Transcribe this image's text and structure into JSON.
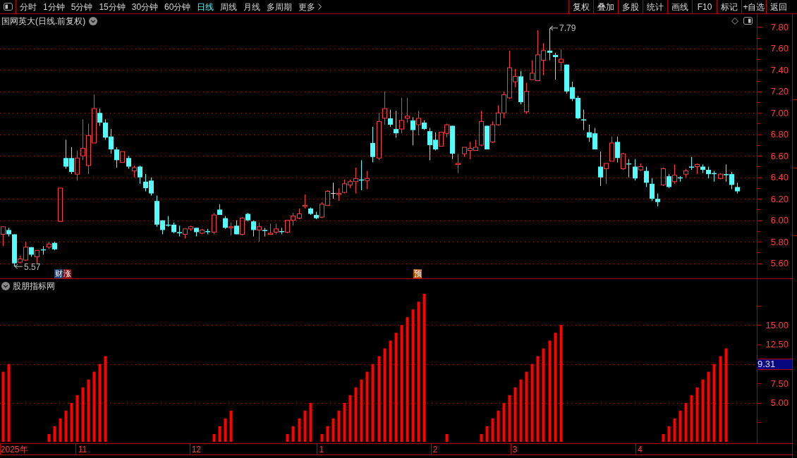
{
  "toolbar": {
    "periods": [
      {
        "label": "分时",
        "selected": false
      },
      {
        "label": "1分钟",
        "selected": false
      },
      {
        "label": "5分钟",
        "selected": false
      },
      {
        "label": "15分钟",
        "selected": false
      },
      {
        "label": "30分钟",
        "selected": false
      },
      {
        "label": "60分钟",
        "selected": false
      },
      {
        "label": "日线",
        "selected": true
      },
      {
        "label": "周线",
        "selected": false
      },
      {
        "label": "月线",
        "selected": false
      },
      {
        "label": "多周期",
        "selected": false
      }
    ],
    "more": "更多",
    "buttons": [
      "复权",
      "叠加",
      "多股",
      "统计",
      "画线",
      "F10",
      "标记",
      "+自选",
      "返回"
    ]
  },
  "price_pane": {
    "title": "国网英大(日线.前复权)",
    "high_label": "7.79",
    "low_label": "5.57",
    "event_tags": [
      {
        "label": "财",
        "color": "#1b3f73"
      },
      {
        "label": "涨",
        "color": "#7d1010"
      },
      {
        "label": "预",
        "color": "#b4520a"
      }
    ],
    "chart_data": [
      {
        "type": "candlestick",
        "tick_labels": "y",
        "grid": true,
        "ylim": [
          5.46,
          7.92
        ],
        "yticks": [
          {
            "value": 5.6,
            "label": "5.60"
          },
          {
            "value": 5.8,
            "label": "5.80"
          },
          {
            "value": 6.0,
            "label": "6.00"
          },
          {
            "value": 6.2,
            "label": "6.20"
          },
          {
            "value": 6.4,
            "label": "6.40"
          },
          {
            "value": 6.6,
            "label": "6.60"
          },
          {
            "value": 6.8,
            "label": "6.80"
          },
          {
            "value": 7.0,
            "label": "7.00"
          },
          {
            "value": 7.2,
            "label": "7.20"
          },
          {
            "value": 7.4,
            "label": "7.40"
          },
          {
            "value": 7.6,
            "label": "7.60"
          },
          {
            "value": 7.8,
            "label": "7.80"
          }
        ],
        "ohlc": [
          [
            5.87,
            5.94,
            5.76,
            5.94
          ],
          [
            5.91,
            5.93,
            5.85,
            5.87
          ],
          [
            5.87,
            5.87,
            5.57,
            5.6
          ],
          [
            5.61,
            5.67,
            5.6,
            5.64
          ],
          [
            5.63,
            5.8,
            5.62,
            5.75
          ],
          [
            5.75,
            5.75,
            5.66,
            5.68
          ],
          [
            5.66,
            5.72,
            5.6,
            5.72
          ],
          [
            5.73,
            5.76,
            5.68,
            5.72
          ],
          [
            5.75,
            5.8,
            5.73,
            5.78
          ],
          [
            5.79,
            5.8,
            5.72,
            5.73
          ],
          [
            5.99,
            6.3,
            5.99,
            6.3
          ],
          [
            6.58,
            6.75,
            6.48,
            6.5
          ],
          [
            6.58,
            6.68,
            6.43,
            6.45
          ],
          [
            6.43,
            6.65,
            6.37,
            6.58
          ],
          [
            6.6,
            6.94,
            6.56,
            6.67
          ],
          [
            6.51,
            6.9,
            6.43,
            6.79
          ],
          [
            6.72,
            7.17,
            6.72,
            7.04
          ],
          [
            7.0,
            7.04,
            6.88,
            6.91
          ],
          [
            6.91,
            6.94,
            6.75,
            6.77
          ],
          [
            6.78,
            6.85,
            6.62,
            6.66
          ],
          [
            6.66,
            6.68,
            6.49,
            6.56
          ],
          [
            6.54,
            6.64,
            6.54,
            6.64
          ],
          [
            6.58,
            6.6,
            6.48,
            6.5
          ],
          [
            6.46,
            6.51,
            6.4,
            6.49
          ],
          [
            6.5,
            6.51,
            6.34,
            6.4
          ],
          [
            6.36,
            6.43,
            6.27,
            6.3
          ],
          [
            6.37,
            6.4,
            6.23,
            6.25
          ],
          [
            6.18,
            6.23,
            5.94,
            5.96
          ],
          [
            6.0,
            6.0,
            5.87,
            5.91
          ],
          [
            5.96,
            6.04,
            5.94,
            5.95
          ],
          [
            5.96,
            5.98,
            5.88,
            5.89
          ],
          [
            5.89,
            5.95,
            5.85,
            5.88
          ],
          [
            5.87,
            5.92,
            5.83,
            5.92
          ],
          [
            5.92,
            5.95,
            5.9,
            5.94
          ],
          [
            5.93,
            5.93,
            5.85,
            5.89
          ],
          [
            5.88,
            5.92,
            5.87,
            5.91
          ],
          [
            5.9,
            5.92,
            5.87,
            5.89
          ],
          [
            5.89,
            6.07,
            5.87,
            6.05
          ],
          [
            6.1,
            6.15,
            6.05,
            6.05
          ],
          [
            6.02,
            6.04,
            5.92,
            5.93
          ],
          [
            5.93,
            5.98,
            5.86,
            5.94
          ],
          [
            5.95,
            6.0,
            5.87,
            5.87
          ],
          [
            5.87,
            6.03,
            5.86,
            6.02
          ],
          [
            6.06,
            6.07,
            5.99,
            6.0
          ],
          [
            5.99,
            6.0,
            5.85,
            5.91
          ],
          [
            5.91,
            5.98,
            5.8,
            5.94
          ],
          [
            5.91,
            5.93,
            5.85,
            5.9
          ],
          [
            5.87,
            5.97,
            5.87,
            5.88
          ],
          [
            5.89,
            5.97,
            5.87,
            5.92
          ],
          [
            5.9,
            5.93,
            5.87,
            5.89
          ],
          [
            5.89,
            6.0,
            5.88,
            6.0
          ],
          [
            6.0,
            6.07,
            5.95,
            6.04
          ],
          [
            6.02,
            6.11,
            6.01,
            6.06
          ],
          [
            6.13,
            6.24,
            6.11,
            6.14
          ],
          [
            6.11,
            6.12,
            6.05,
            6.06
          ],
          [
            6.05,
            6.08,
            6.01,
            6.02
          ],
          [
            6.03,
            6.17,
            6.02,
            6.15
          ],
          [
            6.14,
            6.28,
            6.14,
            6.27
          ],
          [
            6.25,
            6.35,
            6.2,
            6.25
          ],
          [
            6.24,
            6.3,
            6.18,
            6.25
          ],
          [
            6.26,
            6.38,
            6.25,
            6.34
          ],
          [
            6.33,
            6.38,
            6.3,
            6.36
          ],
          [
            6.36,
            6.49,
            6.25,
            6.39
          ],
          [
            6.38,
            6.56,
            6.28,
            6.37
          ],
          [
            6.37,
            6.46,
            6.29,
            6.39
          ],
          [
            6.72,
            6.87,
            6.54,
            6.59
          ],
          [
            6.58,
            7.0,
            6.56,
            6.92
          ],
          [
            6.95,
            7.2,
            6.89,
            7.04
          ],
          [
            6.95,
            7.03,
            6.87,
            6.89
          ],
          [
            6.85,
            7.02,
            6.77,
            6.81
          ],
          [
            6.85,
            7.14,
            6.81,
            6.93
          ],
          [
            6.95,
            7.14,
            6.91,
            6.97
          ],
          [
            6.93,
            6.96,
            6.7,
            6.84
          ],
          [
            6.89,
            7.02,
            6.79,
            6.95
          ],
          [
            6.91,
            6.93,
            6.84,
            6.85
          ],
          [
            6.83,
            6.86,
            6.56,
            6.7
          ],
          [
            6.75,
            6.82,
            6.65,
            6.66
          ],
          [
            6.69,
            6.82,
            6.69,
            6.82
          ],
          [
            6.81,
            6.9,
            6.77,
            6.89
          ],
          [
            6.88,
            6.88,
            6.57,
            6.62
          ],
          [
            6.52,
            6.62,
            6.44,
            6.53
          ],
          [
            6.62,
            6.68,
            6.59,
            6.68
          ],
          [
            6.65,
            6.73,
            6.57,
            6.67
          ],
          [
            6.65,
            6.75,
            6.65,
            6.68
          ],
          [
            6.7,
            7.02,
            6.69,
            6.92
          ],
          [
            6.88,
            6.88,
            6.66,
            6.66
          ],
          [
            6.73,
            6.92,
            6.72,
            6.89
          ],
          [
            6.89,
            7.07,
            6.88,
            7.0
          ],
          [
            7.0,
            7.2,
            6.95,
            7.17
          ],
          [
            7.14,
            7.58,
            7.13,
            7.42
          ],
          [
            7.29,
            7.41,
            7.24,
            7.34
          ],
          [
            7.34,
            7.39,
            7.08,
            7.1
          ],
          [
            7.01,
            7.28,
            6.99,
            7.2
          ],
          [
            7.31,
            7.49,
            7.31,
            7.37
          ],
          [
            7.3,
            7.77,
            7.3,
            7.54
          ],
          [
            7.49,
            7.65,
            7.35,
            7.58
          ],
          [
            7.58,
            7.79,
            7.49,
            7.56
          ],
          [
            7.54,
            7.56,
            7.31,
            7.52
          ],
          [
            7.47,
            7.59,
            7.39,
            7.5
          ],
          [
            7.45,
            7.45,
            7.18,
            7.2
          ],
          [
            7.24,
            7.29,
            7.11,
            7.13
          ],
          [
            7.14,
            7.16,
            6.94,
            6.95
          ],
          [
            6.94,
            7.03,
            6.84,
            6.93
          ],
          [
            6.82,
            6.89,
            6.73,
            6.77
          ],
          [
            6.81,
            6.86,
            6.66,
            6.66
          ],
          [
            6.5,
            6.64,
            6.32,
            6.4
          ],
          [
            6.48,
            6.53,
            6.34,
            6.53
          ],
          [
            6.55,
            6.78,
            6.55,
            6.72
          ],
          [
            6.73,
            6.78,
            6.54,
            6.58
          ],
          [
            6.48,
            6.63,
            6.47,
            6.62
          ],
          [
            6.53,
            6.57,
            6.4,
            6.52
          ],
          [
            6.5,
            6.57,
            6.37,
            6.39
          ],
          [
            6.47,
            6.53,
            6.46,
            6.5
          ],
          [
            6.46,
            6.5,
            6.31,
            6.35
          ],
          [
            6.34,
            6.39,
            6.18,
            6.2
          ],
          [
            6.2,
            6.25,
            6.13,
            6.17
          ],
          [
            6.33,
            6.49,
            6.32,
            6.48
          ],
          [
            6.41,
            6.43,
            6.3,
            6.31
          ],
          [
            6.36,
            6.52,
            6.34,
            6.42
          ],
          [
            6.4,
            6.41,
            6.36,
            6.39
          ],
          [
            6.43,
            6.48,
            6.4,
            6.46
          ],
          [
            6.5,
            6.59,
            6.47,
            6.49
          ],
          [
            6.5,
            6.53,
            6.43,
            6.52
          ],
          [
            6.5,
            6.52,
            6.44,
            6.47
          ],
          [
            6.47,
            6.5,
            6.39,
            6.43
          ],
          [
            6.44,
            6.46,
            6.36,
            6.43
          ],
          [
            6.39,
            6.44,
            6.38,
            6.43
          ],
          [
            6.43,
            6.52,
            6.36,
            6.42
          ],
          [
            6.43,
            6.45,
            6.29,
            6.33
          ],
          [
            6.31,
            6.35,
            6.25,
            6.27
          ],
          null,
          null,
          null
        ]
      }
    ]
  },
  "indicator_pane": {
    "title": "股朋指标网",
    "current_value": "9.31",
    "chart_data": [
      {
        "type": "bar",
        "color": "#ff0000",
        "grid": true,
        "ylim": [
          0,
          21
        ],
        "yticks": [
          {
            "value": 5,
            "label": "5.00"
          },
          {
            "value": 7.5,
            "label": "7.50"
          },
          {
            "value": 12.5,
            "label": "12.50"
          },
          {
            "value": 15,
            "label": "15.00"
          }
        ],
        "categories": [
          null,
          null,
          "2025年",
          null,
          null,
          null,
          null,
          null,
          null,
          null,
          null,
          null,
          null,
          null,
          "11",
          null,
          null,
          null,
          null,
          null,
          null,
          null,
          null,
          null,
          null,
          null,
          null,
          null,
          null,
          null,
          null,
          null,
          null,
          null,
          "12",
          null,
          null,
          null,
          null,
          null,
          null,
          null,
          null,
          null,
          null,
          null,
          null,
          null,
          null,
          null,
          null,
          null,
          null,
          null,
          null,
          null,
          "1",
          null,
          null,
          null,
          null,
          null,
          null,
          null,
          null,
          null,
          null,
          null,
          null,
          null,
          null,
          null,
          null,
          null,
          null,
          null,
          "2",
          null,
          null,
          null,
          null,
          null,
          null,
          null,
          null,
          null,
          null,
          null,
          null,
          null,
          "3",
          null,
          null,
          null,
          null,
          null,
          null,
          null,
          null,
          null,
          null,
          null,
          null,
          null,
          null,
          null,
          null,
          null,
          null,
          null,
          null,
          null,
          "4",
          null,
          null,
          null,
          null,
          null,
          null,
          null,
          null,
          null,
          null,
          null,
          null,
          null,
          null,
          null,
          null,
          null,
          null,
          null,
          null
        ],
        "values": [
          9,
          10,
          0,
          0,
          0,
          0,
          0,
          0,
          1,
          2,
          3,
          4,
          5,
          6,
          7,
          8,
          9,
          10,
          11,
          0,
          0,
          0,
          0,
          0,
          0,
          0,
          0,
          0,
          0,
          0,
          0,
          0,
          0,
          0,
          0,
          0,
          0,
          1,
          2,
          3,
          4,
          0,
          0,
          0,
          0,
          0,
          0,
          0,
          0,
          0,
          1,
          2,
          3,
          4,
          5,
          0,
          1,
          2,
          3,
          4,
          5,
          6,
          7,
          8,
          9,
          10,
          11,
          12,
          13,
          14,
          15,
          16,
          17,
          18,
          19,
          0,
          0,
          0,
          1,
          0,
          0,
          0,
          0,
          0,
          1,
          2,
          3,
          4,
          5,
          6,
          7,
          8,
          9,
          10,
          11,
          12,
          13,
          14,
          15,
          0,
          0,
          0,
          0,
          0,
          0,
          0,
          0,
          0,
          0,
          0,
          0,
          0,
          0,
          0,
          0,
          0,
          1,
          2,
          3,
          4,
          5,
          6,
          7,
          8,
          9,
          10,
          11,
          12,
          0,
          0,
          null,
          null,
          null
        ]
      }
    ]
  }
}
